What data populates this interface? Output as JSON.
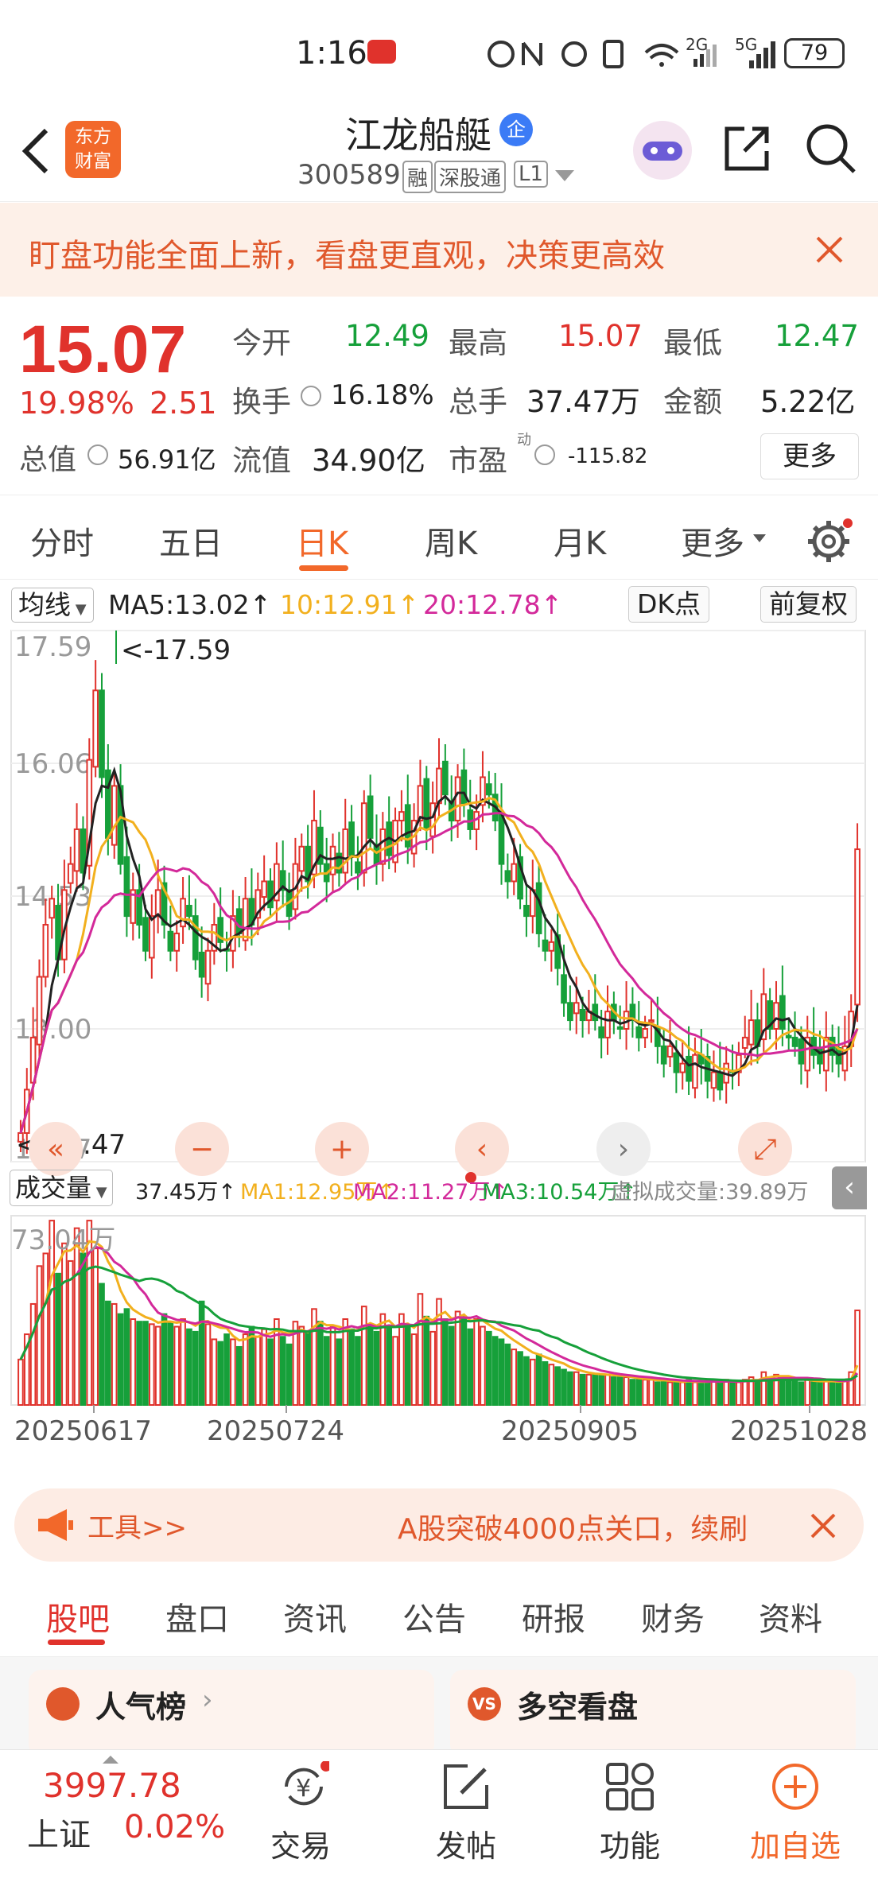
{
  "status": {
    "time": "1:16",
    "battery": "79",
    "net1": "2G",
    "net2": "5G"
  },
  "header": {
    "stock_name": "江龙船艇",
    "corp_badge": "企",
    "code": "300589",
    "tag_rong": "融",
    "tag_sgt": "深股通",
    "tag_l1": "L1",
    "logo_top": "东方",
    "logo_bottom": "财富"
  },
  "banner": {
    "text": "盯盘功能全面上新，看盘更直观，决策更高效"
  },
  "quote": {
    "price": "15.07",
    "change_pct": "19.98%",
    "change_amt": "2.51",
    "open_label": "今开",
    "open": "12.49",
    "high_label": "最高",
    "high": "15.07",
    "low_label": "最低",
    "low": "12.47",
    "turnover_label": "换手",
    "turnover": "16.18%",
    "volume_label": "总手",
    "volume": "37.47万",
    "amount_label": "金额",
    "amount": "5.22亿",
    "mcap_label": "总值",
    "mcap": "56.91亿",
    "float_label": "流值",
    "float": "34.90亿",
    "pe_label": "市盈",
    "pe_sup": "动",
    "pe": "-115.82",
    "more_button": "更多"
  },
  "period_tabs": [
    "分时",
    "五日",
    "日K",
    "周K",
    "月K",
    "更多"
  ],
  "active_period_index": 2,
  "chart_controls": {
    "ma_select": "均线",
    "ma5": "MA5:13.02↑",
    "ma10": "10:12.91↑",
    "ma20": "20:12.78↑",
    "dk_button": "DK点",
    "adjust_button": "前复权",
    "vol_select": "成交量",
    "vol_value": "37.45万↑",
    "vma1": "MA1:12.95万↑",
    "vma2": "MA2:11.27万↑",
    "vma3": "MA3:10.54万↑",
    "virtual_vol": "虚拟成交量:39.89万"
  },
  "chart_data": {
    "type": "candlestick",
    "y_ticks": [
      "17.59",
      "16.06",
      "14.53",
      "13.00",
      "11.47"
    ],
    "ylim": [
      11.47,
      17.59
    ],
    "max_marker": "<-17.59",
    "min_marker": "<-11.47",
    "x_ticks": [
      "20250617",
      "20250724",
      "20250905",
      "20251028"
    ],
    "vol_max_label": "73.04万",
    "colors": {
      "up": "#e0322c",
      "down": "#16a03a",
      "ma5": "#222222",
      "ma10": "#f2b01e",
      "ma20": "#d3299a"
    },
    "closes": [
      11.8,
      12.3,
      12.9,
      13.6,
      14.2,
      14.5,
      13.8,
      14.6,
      14.9,
      15.3,
      14.8,
      16.1,
      16.9,
      15.9,
      15.2,
      15.8,
      14.9,
      14.3,
      14.6,
      14.2,
      13.9,
      14.3,
      14.6,
      14.2,
      13.9,
      14.1,
      14.5,
      14.3,
      13.8,
      13.6,
      13.9,
      14.2,
      14.0,
      13.9,
      14.3,
      14.1,
      14.5,
      14.2,
      14.6,
      14.7,
      14.4,
      14.9,
      14.6,
      14.3,
      14.9,
      15.1,
      14.7,
      15.4,
      14.9,
      14.7,
      15.1,
      14.8,
      15.3,
      15.0,
      14.8,
      15.6,
      15.2,
      14.9,
      15.3,
      15.0,
      15.4,
      15.5,
      15.1,
      15.4,
      15.8,
      15.3,
      15.6,
      16.0,
      15.7,
      15.4,
      15.9,
      15.6,
      15.3,
      15.5,
      15.9,
      15.7,
      15.4,
      14.9,
      14.7,
      14.9,
      14.5,
      14.3,
      14.6,
      14.1,
      13.9,
      14.0,
      13.7,
      13.3,
      13.1,
      13.3,
      13.1,
      13.2,
      13.1,
      12.9,
      13.2,
      13.1,
      13.0,
      13.2,
      13.1,
      12.9,
      13.0,
      13.1,
      12.8,
      12.6,
      12.8,
      12.5,
      12.6,
      12.4,
      12.7,
      12.6,
      12.4,
      12.5,
      12.3,
      12.6,
      12.5,
      12.7,
      12.9,
      13.1,
      12.8,
      13.4,
      13.0,
      13.3,
      13.0,
      12.9,
      12.8,
      12.6,
      12.9,
      12.7,
      12.6,
      12.9,
      12.7,
      12.6,
      12.8,
      13.2,
      15.07
    ],
    "volumes": [
      18,
      28,
      40,
      55,
      60,
      73,
      52,
      64,
      57,
      70,
      60,
      73,
      62,
      48,
      41,
      40,
      36,
      38,
      34,
      33,
      33,
      32,
      31,
      36,
      33,
      31,
      34,
      30,
      29,
      41,
      32,
      26,
      25,
      28,
      26,
      23,
      28,
      31,
      27,
      30,
      26,
      34,
      27,
      24,
      33,
      31,
      29,
      38,
      33,
      27,
      31,
      26,
      34,
      30,
      27,
      39,
      32,
      29,
      36,
      31,
      27,
      36,
      31,
      28,
      44,
      35,
      29,
      42,
      34,
      31,
      37,
      35,
      30,
      34,
      31,
      29,
      27,
      26,
      24,
      22,
      21,
      19,
      18,
      20,
      17,
      16,
      15,
      14,
      13,
      13,
      12,
      12,
      12,
      12,
      12,
      11,
      11,
      11,
      10,
      10,
      10,
      10,
      9,
      10,
      9,
      9,
      9,
      10,
      9,
      9,
      9,
      10,
      9,
      10,
      9,
      9,
      10,
      11,
      10,
      13,
      11,
      12,
      11,
      10,
      10,
      9,
      10,
      9,
      9,
      10,
      9,
      9,
      10,
      13,
      37.45
    ]
  },
  "chart_buttons": [
    "«",
    "−",
    "+",
    "‹",
    "›",
    "⤢"
  ],
  "ad": {
    "left": "工具>>",
    "right": "A股突破4000点关口，续刷"
  },
  "sub_tabs": [
    "股吧",
    "盘口",
    "资讯",
    "公告",
    "研报",
    "财务",
    "资料"
  ],
  "active_sub_tab_index": 0,
  "cards": [
    {
      "icon": "bar-chart-icon",
      "label": "人气榜"
    },
    {
      "icon": "vs-icon",
      "label": "多空看盘"
    }
  ],
  "bottom_nav": {
    "index_value": "3997.78",
    "index_name": "上证",
    "index_change": "0.02%",
    "trade": "交易",
    "post": "发帖",
    "functions": "功能",
    "add": "加自选"
  }
}
